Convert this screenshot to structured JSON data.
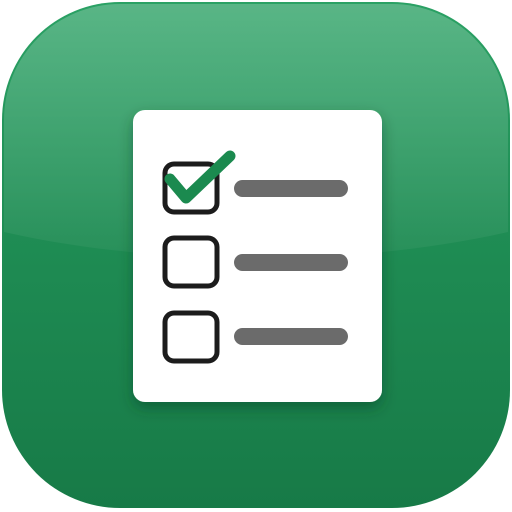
{
  "icon": {
    "name": "checklist-app-icon",
    "colors": {
      "tile_light": "#2a9f62",
      "tile": "#1e8a52",
      "tile_dark": "#157443",
      "paper": "#ffffff",
      "check": "#1b8a4f",
      "box_stroke": "#1c1c1c",
      "line": "#6b6b6b"
    },
    "items": [
      {
        "checked": true
      },
      {
        "checked": false
      },
      {
        "checked": false
      }
    ]
  }
}
